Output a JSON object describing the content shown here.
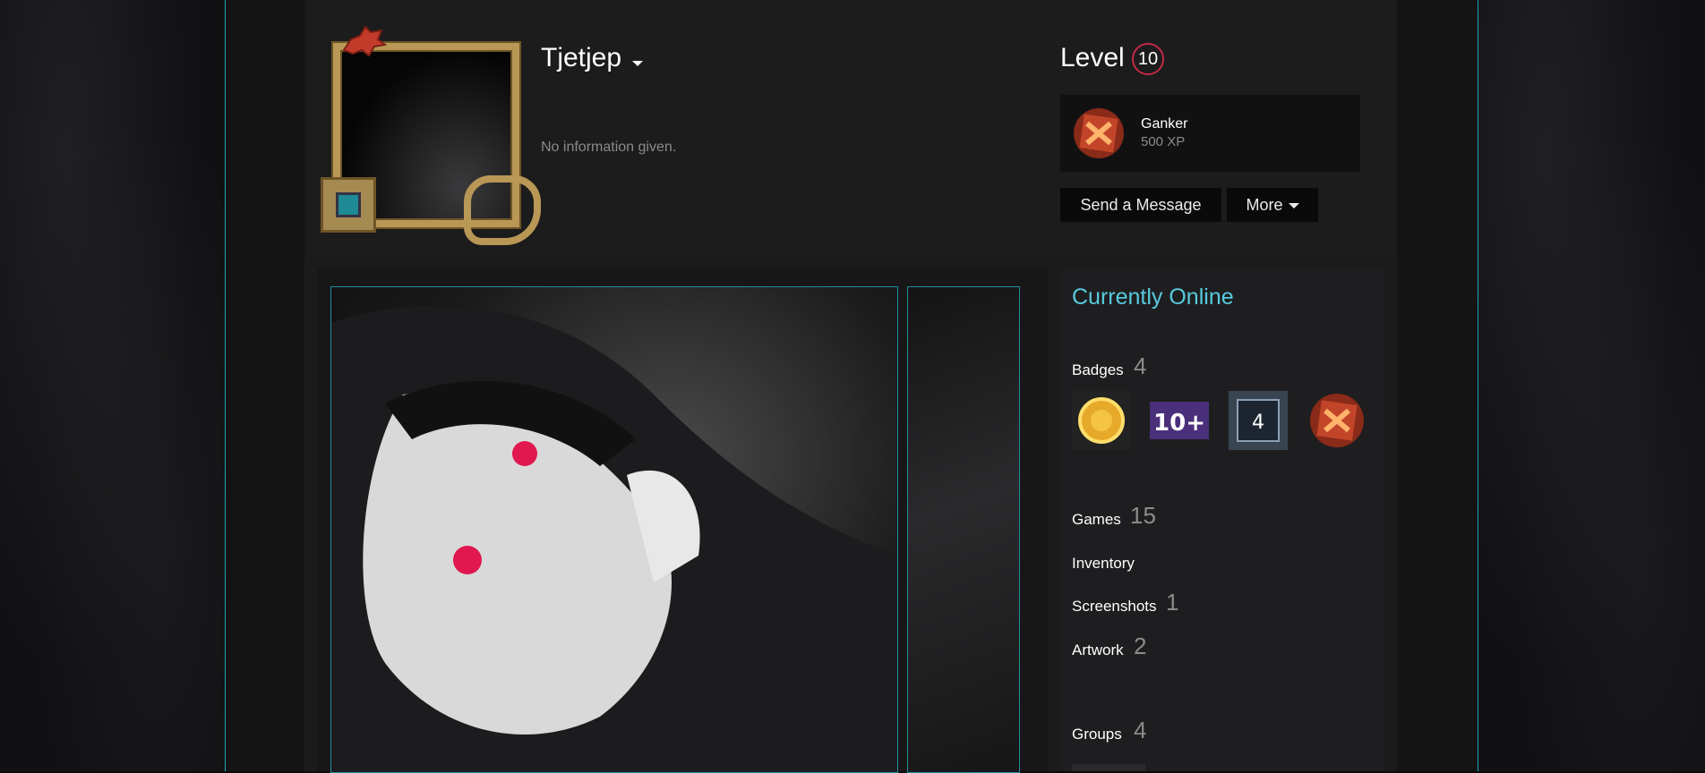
{
  "profile": {
    "persona_name": "Tjetjep",
    "summary": "No information given."
  },
  "level": {
    "label": "Level",
    "value": "10"
  },
  "featured_badge": {
    "name": "Ganker",
    "xp": "500 XP",
    "icon": "dota-badge-icon"
  },
  "actions": {
    "send_message": "Send a Message",
    "more": "More"
  },
  "sidebar": {
    "status": "Currently Online",
    "badges_label": "Badges",
    "badges_count": "4",
    "badges": [
      {
        "icon": "gold-coin-badge-icon"
      },
      {
        "icon": "10-plus-badge-icon",
        "text": "10+"
      },
      {
        "icon": "years-service-badge-icon",
        "text": "4"
      },
      {
        "icon": "dota-badge-icon"
      }
    ],
    "games_label": "Games",
    "games_count": "15",
    "inventory_label": "Inventory",
    "screenshots_label": "Screenshots",
    "screenshots_count": "1",
    "artwork_label": "Artwork",
    "artwork_count": "2",
    "groups_label": "Groups",
    "groups_count": "4"
  },
  "colors": {
    "accent_cyan": "#57cbde",
    "frame_line": "#1aa8b6",
    "level_ring": "#c02942"
  }
}
